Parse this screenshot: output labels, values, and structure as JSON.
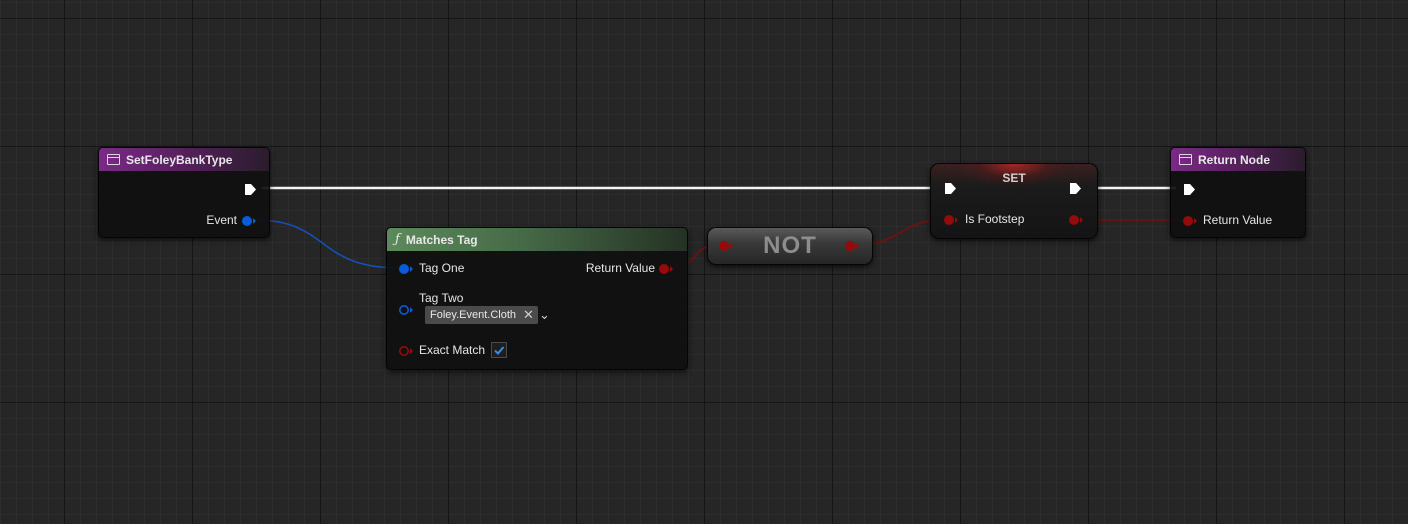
{
  "nodes": {
    "set_foley_bank_type": {
      "title": "SetFoleyBankType",
      "event_label": "Event"
    },
    "matches_tag": {
      "icon": "ƒ",
      "title": "Matches Tag",
      "tag_one_label": "Tag One",
      "return_value_label": "Return Value",
      "tag_two_label": "Tag Two",
      "tag_two_value": "Foley.Event.Cloth",
      "exact_match_label": "Exact Match",
      "exact_match_checked": true
    },
    "not": {
      "title": "NOT"
    },
    "set": {
      "title": "SET",
      "is_footstep_label": "Is Footstep"
    },
    "return_node": {
      "title": "Return Node",
      "return_value_label": "Return Value"
    }
  },
  "colors": {
    "exec_wire": "#ffffff",
    "struct_pin": "#0a5bd8",
    "bool_pin": "#950b0b",
    "bool_wire": "#7a0d0d",
    "struct_wire": "#1550b8",
    "event_header": "#7a2a86",
    "function_header": "#5c8a5c"
  },
  "icons": {
    "event_node": "event-graph-icon",
    "function": "function-icon",
    "tag_clear": "close-icon",
    "tag_dropdown": "chevron-down-icon",
    "checkbox": "checkmark-icon"
  }
}
